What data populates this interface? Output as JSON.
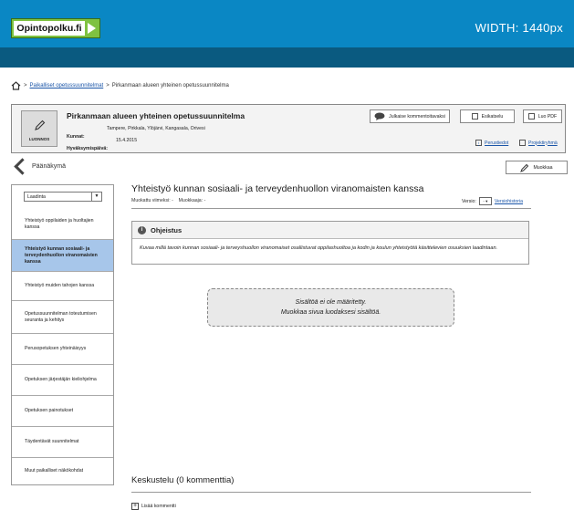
{
  "header": {
    "logo_text": "Opintopolku.fi",
    "width_label": "WIDTH: 1440px"
  },
  "breadcrumb": {
    "items": [
      {
        "label": "Paikalliset opetussuunnitelmat",
        "link": true
      },
      {
        "label": "Pirkanmaan alueen yhteinen opetussuunnitelma",
        "link": false
      }
    ],
    "sep": ">"
  },
  "plan": {
    "status": "LUONNOS",
    "title": "Pirkanmaan alueen yhteinen opetussuunnitelma",
    "municipalities_label": "Kunnat:",
    "municipalities_value": "Tampere, Pirkkala, Ylöjärvi, Kangasala, Orivesi",
    "approval_label": "Hyväksymispäivä:",
    "approval_value": "15.4.2015"
  },
  "panel_actions": {
    "publish_label": "Julkaise kommentoitavaksi",
    "preview_label": "Esikatselu",
    "pdf_label": "Luo PDF",
    "info_label": "Perustiedot",
    "group_label": "Projektiryhmä"
  },
  "nav": {
    "back_label": "Päänäkymä",
    "edit_label": "Muokkaa",
    "select_value": "Laadinta",
    "items": [
      {
        "label": "Yhteistyö oppilaiden ja huoltajien kanssa",
        "active": false
      },
      {
        "label": "Yhteistyö kunnan sosiaali- ja terveydenhuollon viranomaisten kanssa",
        "active": true
      },
      {
        "label": "Yhteistyö muiden tahojen kanssa",
        "active": false
      },
      {
        "label": "Opetussuunnitelman toteutumisen seuranta ja kehitys",
        "active": false
      },
      {
        "label": "Perusopetuksen yhteinäisyys",
        "active": false
      },
      {
        "label": "Opetuksen järjestäjän kieliohjelma",
        "active": false
      },
      {
        "label": "Opetuksen painotukset",
        "active": false
      },
      {
        "label": "Täydentävät suunnitelmat",
        "active": false
      },
      {
        "label": "Muut paikalliset näkökohdat",
        "active": false
      }
    ]
  },
  "main": {
    "title": "Yhteistyö kunnan sosiaali- ja terveydenhuollon viranomaisten kanssa",
    "modified_label": "Muokattu viimeksi: -",
    "editor_label": "Muokkaaja: -",
    "version_label": "Versio:",
    "version_value": "-",
    "history_label": "Versiohistoria",
    "guide_title": "Ohjeistus",
    "guide_text": "Kuvaa millä tavoin kunnan sosiaali- ja terveyshuollon viranomaiset osallistuvat oppilashuoltoa ja kodin ja koulun yhteistyötä käsittelevien osuuksien laadintaan.",
    "empty_line1": "Sisältöä ei ole määritetty.",
    "empty_line2": "Muokkaa sivua luodaksesi sisältöä.",
    "discussion_title": "Keskustelu (0 kommenttia)",
    "add_comment_label": "Lisää kommentti"
  }
}
